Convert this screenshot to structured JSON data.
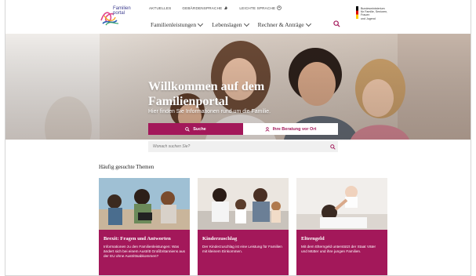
{
  "brand": {
    "logo_line1": "Familien",
    "logo_line2": "portal"
  },
  "meta_nav": [
    {
      "label": "AKTUELLES"
    },
    {
      "label": "GEBÄRDENSPRACHE"
    },
    {
      "label": "LEICHTE SPRACHE"
    }
  ],
  "main_nav": [
    {
      "label": "Familienleistungen"
    },
    {
      "label": "Lebenslagen"
    },
    {
      "label": "Rechner & Anträge"
    }
  ],
  "ministry": {
    "line1": "Bundesministerium",
    "line2": "für Familie, Senioren, Frauen",
    "line3": "und Jugend"
  },
  "hero": {
    "title_line1": "Willkommen auf dem",
    "title_line2": "Familienportal",
    "subtitle": "Hier finden Sie Informationen rund um die Familie."
  },
  "tabs": {
    "search_label": "Suche",
    "advice_label": "Ihre Beratung vor Ort"
  },
  "search": {
    "placeholder": "Wonach suchen Sie?"
  },
  "section": {
    "title": "Häufig gesuchte Themen"
  },
  "cards": [
    {
      "title": "Brexit: Fragen und Antworten",
      "text": "Informationen zu den Familienleistungen: Was ändert sich bei einem Austritt Großbritanniens aus der EU ohne Austrittsabkommen?"
    },
    {
      "title": "Kinderzuschlag",
      "text": "Der Kinderzuschlag ist eine Leistung für Familien mit kleinem Einkommen."
    },
    {
      "title": "Elterngeld",
      "text": "Mit dem Elterngeld unterstützt der Staat Väter und Mütter und ihre jungen Familien."
    }
  ],
  "colors": {
    "accent": "#a3185a",
    "hero_text": "#ffffff"
  }
}
